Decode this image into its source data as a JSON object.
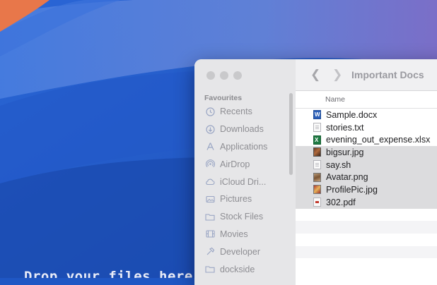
{
  "desktop": {
    "drop_text": "Drop your files here"
  },
  "finder": {
    "sidebar": {
      "section_title": "Favourites",
      "items": [
        {
          "label": "Recents",
          "icon": "clock-icon"
        },
        {
          "label": "Downloads",
          "icon": "download-icon"
        },
        {
          "label": "Applications",
          "icon": "applications-icon"
        },
        {
          "label": "AirDrop",
          "icon": "airdrop-icon"
        },
        {
          "label": "iCloud Dri...",
          "icon": "cloud-icon"
        },
        {
          "label": "Pictures",
          "icon": "pictures-icon"
        },
        {
          "label": "Stock Files",
          "icon": "folder-icon"
        },
        {
          "label": "Movies",
          "icon": "film-icon"
        },
        {
          "label": "Developer",
          "icon": "hammer-icon"
        },
        {
          "label": "dockside",
          "icon": "folder-icon"
        }
      ]
    },
    "toolbar": {
      "title": "Important Docs"
    },
    "columns": {
      "name": "Name"
    },
    "files": [
      {
        "name": "Sample.docx",
        "type": "word",
        "selected": false
      },
      {
        "name": "stories.txt",
        "type": "txt",
        "selected": false
      },
      {
        "name": "evening_out_expense.xlsx",
        "type": "excel",
        "selected": false
      },
      {
        "name": "bigsur.jpg",
        "type": "img",
        "selected": true
      },
      {
        "name": "say.sh",
        "type": "txt",
        "selected": true
      },
      {
        "name": "Avatar.png",
        "type": "img2",
        "selected": true
      },
      {
        "name": "ProfilePic.jpg",
        "type": "img3",
        "selected": true
      },
      {
        "name": "302.pdf",
        "type": "pdf",
        "selected": true
      }
    ]
  }
}
